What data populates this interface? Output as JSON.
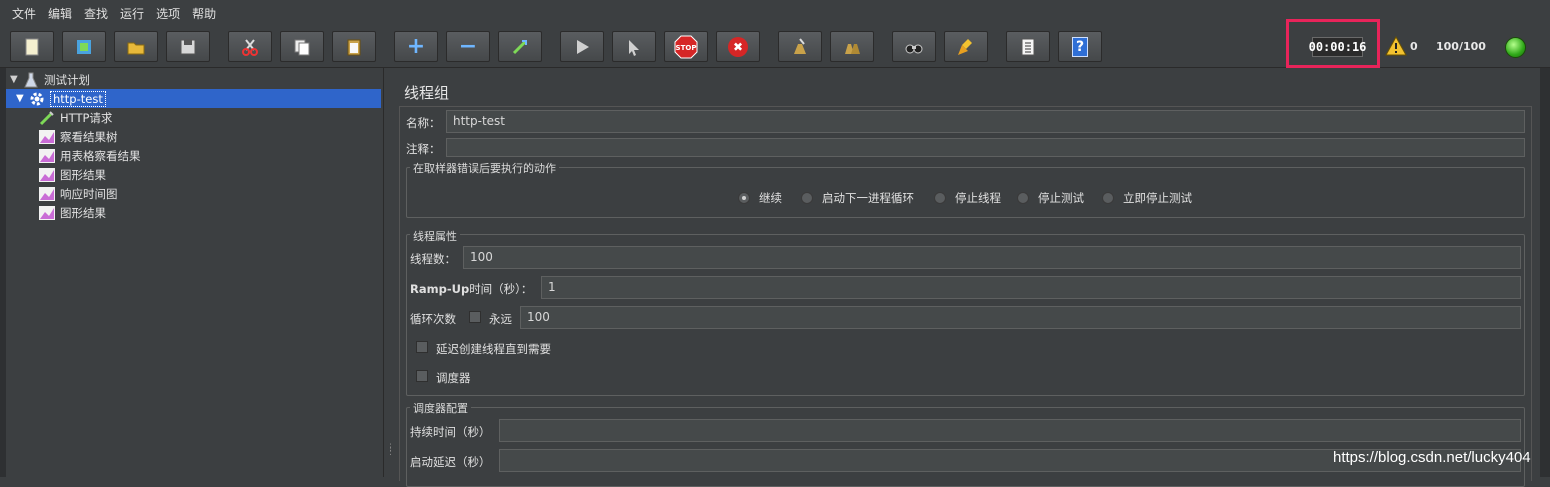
{
  "menu": [
    "文件",
    "编辑",
    "查找",
    "运行",
    "选项",
    "帮助"
  ],
  "toolbar": {
    "buttons": [
      {
        "name": "new-icon"
      },
      {
        "name": "templates-icon"
      },
      {
        "name": "open-icon"
      },
      {
        "name": "save-icon"
      },
      {
        "name": "cut-icon"
      },
      {
        "name": "copy-icon"
      },
      {
        "name": "paste-icon"
      },
      {
        "name": "expand-icon",
        "glyph": "+"
      },
      {
        "name": "collapse-icon",
        "glyph": "−"
      },
      {
        "name": "toggle-icon"
      },
      {
        "name": "start-icon"
      },
      {
        "name": "start-no-pause-icon"
      },
      {
        "name": "stop-icon",
        "glyph": "STOP"
      },
      {
        "name": "shutdown-icon",
        "glyph": "✖"
      },
      {
        "name": "clear-icon"
      },
      {
        "name": "clear-all-icon"
      },
      {
        "name": "search-icon"
      },
      {
        "name": "reset-search-icon"
      },
      {
        "name": "function-helper-icon"
      },
      {
        "name": "help-icon",
        "glyph": "?"
      }
    ]
  },
  "status": {
    "timer": "00:00:16",
    "warnings": "0",
    "threads": "100/100",
    "running_color": "#2fa818",
    "highlight_color": "#e8245a"
  },
  "tree": {
    "root": "测试计划",
    "thread_group": "http-test",
    "children": [
      "HTTP请求",
      "察看结果树",
      "用表格察看结果",
      "图形结果",
      "响应时间图",
      "图形结果"
    ]
  },
  "panel": {
    "title": "线程组",
    "name_label": "名称：",
    "name_value": "http-test",
    "comment_label": "注释：",
    "comment_value": "",
    "error_group_title": "在取样器错误后要执行的动作",
    "error_actions": [
      "继续",
      "启动下一进程循环",
      "停止线程",
      "停止测试",
      "立即停止测试"
    ],
    "error_selected": "继续",
    "thread_props_title": "线程属性",
    "threads_label": "线程数：",
    "threads_value": "100",
    "rampup_label_bold": "Ramp-Up",
    "rampup_label_rest": "时间（秒）：",
    "rampup_value": "1",
    "loop_label": "循环次数",
    "forever_label": "永远",
    "forever_checked": false,
    "loop_value": "100",
    "delay_label": "延迟创建线程直到需要",
    "delay_checked": false,
    "scheduler_label": "调度器",
    "scheduler_checked": false,
    "scheduler_config_title": "调度器配置",
    "duration_label": "持续时间（秒）",
    "duration_value": "",
    "startup_delay_label": "启动延迟（秒）",
    "startup_delay_value": ""
  },
  "watermark": "https://blog.csdn.net/lucky404"
}
